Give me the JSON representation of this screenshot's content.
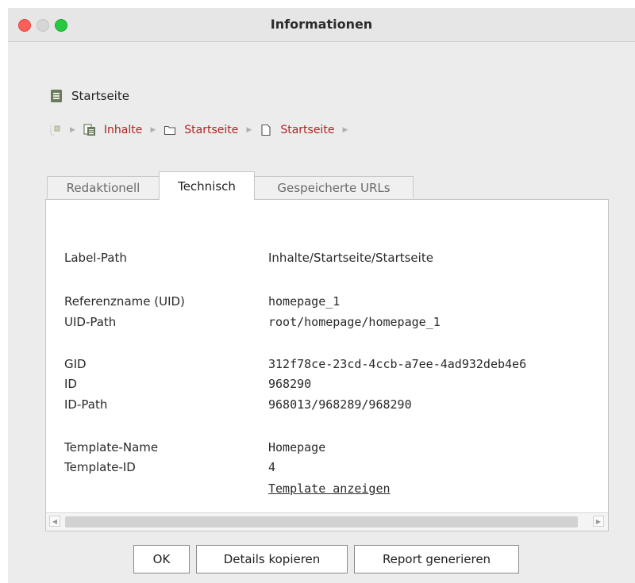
{
  "window": {
    "title": "Informationen",
    "traffic_lights": [
      "close",
      "minimize",
      "maximize"
    ]
  },
  "page": {
    "title": "Startseite",
    "icon": "document-icon"
  },
  "breadcrumb": {
    "items": [
      {
        "label": "Inhalte",
        "icon": "content-store-icon"
      },
      {
        "label": "Startseite",
        "icon": "folder-icon"
      },
      {
        "label": "Startseite",
        "icon": "page-icon"
      }
    ],
    "link_color": "#b22222"
  },
  "tabs": [
    {
      "label": "Redaktionell",
      "active": false
    },
    {
      "label": "Technisch",
      "active": true
    },
    {
      "label": "Gespeicherte URLs",
      "active": false
    }
  ],
  "fields": {
    "label_path": {
      "label": "Label-Path",
      "value": "Inhalte/Startseite/Startseite"
    },
    "ref_name": {
      "label": "Referenzname (UID)",
      "value": "homepage_1"
    },
    "uid_path": {
      "label": "UID-Path",
      "value": "root/homepage/homepage_1"
    },
    "gid": {
      "label": "GID",
      "value": "312f78ce-23cd-4ccb-a7ee-4ad932deb4e6"
    },
    "id": {
      "label": "ID",
      "value": "968290"
    },
    "id_path": {
      "label": "ID-Path",
      "value": "968013/968289/968290"
    },
    "template_name": {
      "label": "Template-Name",
      "value": "Homepage"
    },
    "template_id": {
      "label": "Template-ID",
      "value": "4"
    },
    "template_link": "Template anzeigen"
  },
  "buttons": {
    "ok": "OK",
    "copy": "Details kopieren",
    "report": "Report generieren"
  }
}
